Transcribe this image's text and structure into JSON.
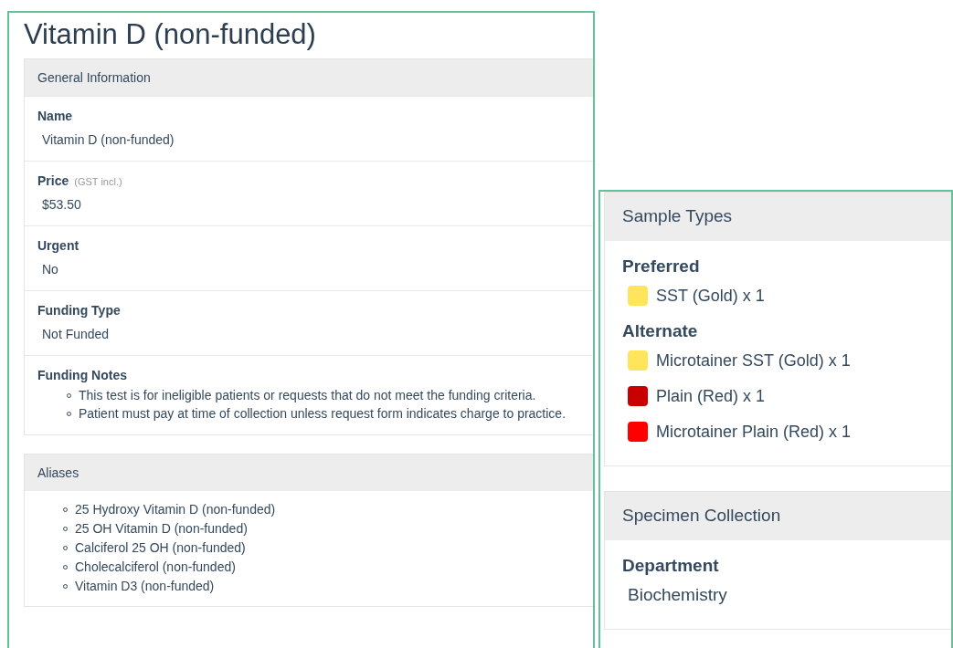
{
  "title": "Vitamin D (non-funded)",
  "general_information": {
    "heading": "General Information",
    "fields": [
      {
        "kind": "text",
        "label": "Name",
        "value": "Vitamin D (non-funded)"
      },
      {
        "kind": "text",
        "label": "Price",
        "note": "(GST incl.)",
        "value": "$53.50"
      },
      {
        "kind": "text",
        "label": "Urgent",
        "value": "No"
      },
      {
        "kind": "text",
        "label": "Funding Type",
        "value": "Not Funded"
      },
      {
        "kind": "list",
        "label": "Funding Notes",
        "items": [
          "This test is for ineligible patients or requests that do not meet the funding criteria.",
          "Patient must pay at time of collection unless request form indicates charge to practice."
        ]
      }
    ]
  },
  "aliases": {
    "heading": "Aliases",
    "items": [
      "25 Hydroxy Vitamin D (non-funded)",
      "25 OH Vitamin D (non-funded)",
      "Calciferol 25 OH (non-funded)",
      "Cholecalciferol (non-funded)",
      "Vitamin D3 (non-funded)"
    ]
  },
  "sample_types": {
    "heading": "Sample Types",
    "groups": [
      {
        "label": "Preferred",
        "items": [
          {
            "name": "SST (Gold) x 1",
            "color": "#ffe55c"
          }
        ]
      },
      {
        "label": "Alternate",
        "items": [
          {
            "name": "Microtainer SST (Gold) x 1",
            "color": "#ffe55c"
          },
          {
            "name": "Plain (Red) x 1",
            "color": "#c80000"
          },
          {
            "name": "Microtainer Plain (Red) x 1",
            "color": "#ff0000"
          }
        ]
      }
    ]
  },
  "specimen_collection": {
    "heading": "Specimen Collection",
    "fields": [
      {
        "label": "Department",
        "value": "Biochemistry"
      }
    ]
  }
}
